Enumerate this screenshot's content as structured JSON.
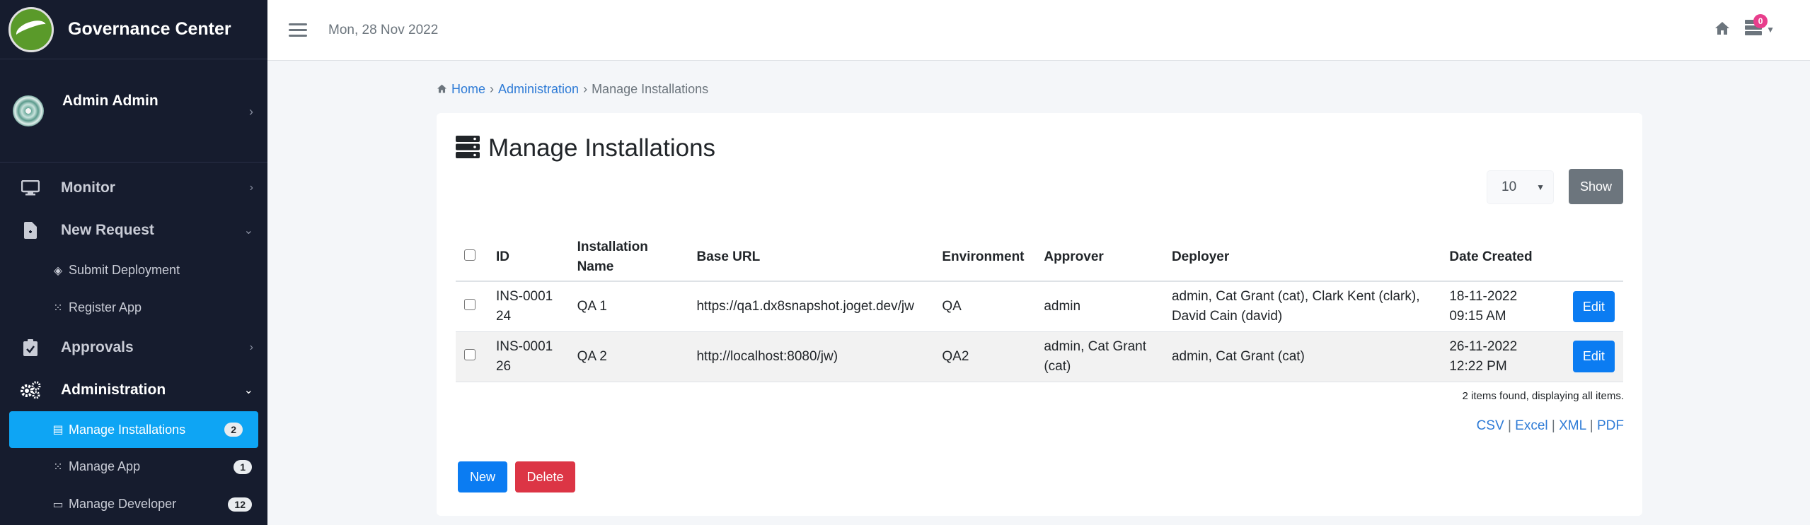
{
  "app": {
    "title": "Governance Center"
  },
  "user": {
    "name": "Admin Admin"
  },
  "topbar": {
    "date": "Mon, 28 Nov 2022",
    "notification_count": "0"
  },
  "nav": {
    "monitor": "Monitor",
    "new_request": "New Request",
    "submit_deployment": "Submit Deployment",
    "register_app": "Register App",
    "approvals": "Approvals",
    "administration": "Administration",
    "manage_installations": {
      "label": "Manage Installations",
      "count": "2"
    },
    "manage_app": {
      "label": "Manage App",
      "count": "1"
    },
    "manage_developer": {
      "label": "Manage Developer",
      "count": "12"
    }
  },
  "breadcrumb": {
    "home": "Home",
    "administration": "Administration",
    "current": "Manage Installations"
  },
  "page": {
    "title": "Manage Installations"
  },
  "pager": {
    "page_size": "10",
    "show_label": "Show"
  },
  "table": {
    "headers": [
      "ID",
      "Installation Name",
      "Base URL",
      "Environment",
      "Approver",
      "Deployer",
      "Date Created"
    ],
    "rows": [
      {
        "id": "INS-000124",
        "name": "QA 1",
        "base_url": "https://qa1.dx8snapshot.joget.dev/jw",
        "environment": "QA",
        "approver": "admin",
        "deployer": "admin, Cat Grant (cat), Clark Kent (clark), David Cain (david)",
        "date_created": "18-11-2022 09:15 AM",
        "action": "Edit"
      },
      {
        "id": "INS-000126",
        "name": "QA 2",
        "base_url": "http://localhost:8080/jw)",
        "environment": "QA2",
        "approver": "admin, Cat Grant (cat)",
        "deployer": "admin, Cat Grant (cat)",
        "date_created": "26-11-2022 12:22 PM",
        "action": "Edit"
      }
    ],
    "summary": "2 items found, displaying all items."
  },
  "exports": {
    "csv": "CSV",
    "excel": "Excel",
    "xml": "XML",
    "pdf": "PDF",
    "separator": "|"
  },
  "actions": {
    "new": "New",
    "delete": "Delete"
  },
  "colors": {
    "sidebar_bg": "#161c2e",
    "active_item": "#0ea5f4",
    "primary": "#0b7cf2",
    "danger": "#dc3545",
    "secondary": "#6c757d"
  }
}
